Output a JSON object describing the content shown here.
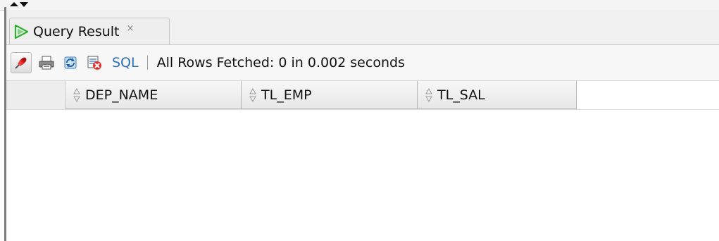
{
  "tab": {
    "label": "Query Result",
    "close_glyph": "×",
    "icon": "run-triangle-icon",
    "icon_color": "#2eaf2e"
  },
  "toolbar": {
    "icons": [
      "pin-icon",
      "print-icon",
      "refresh-icon",
      "cancel-fetch-icon"
    ],
    "sql_label": "SQL",
    "sql_color": "#2f6fbf",
    "status": "All Rows Fetched: 0 in 0.002 seconds"
  },
  "grid": {
    "columns": [
      {
        "label": "DEP_NAME"
      },
      {
        "label": "TL_EMP"
      },
      {
        "label": "TL_SAL"
      }
    ],
    "rows": []
  }
}
